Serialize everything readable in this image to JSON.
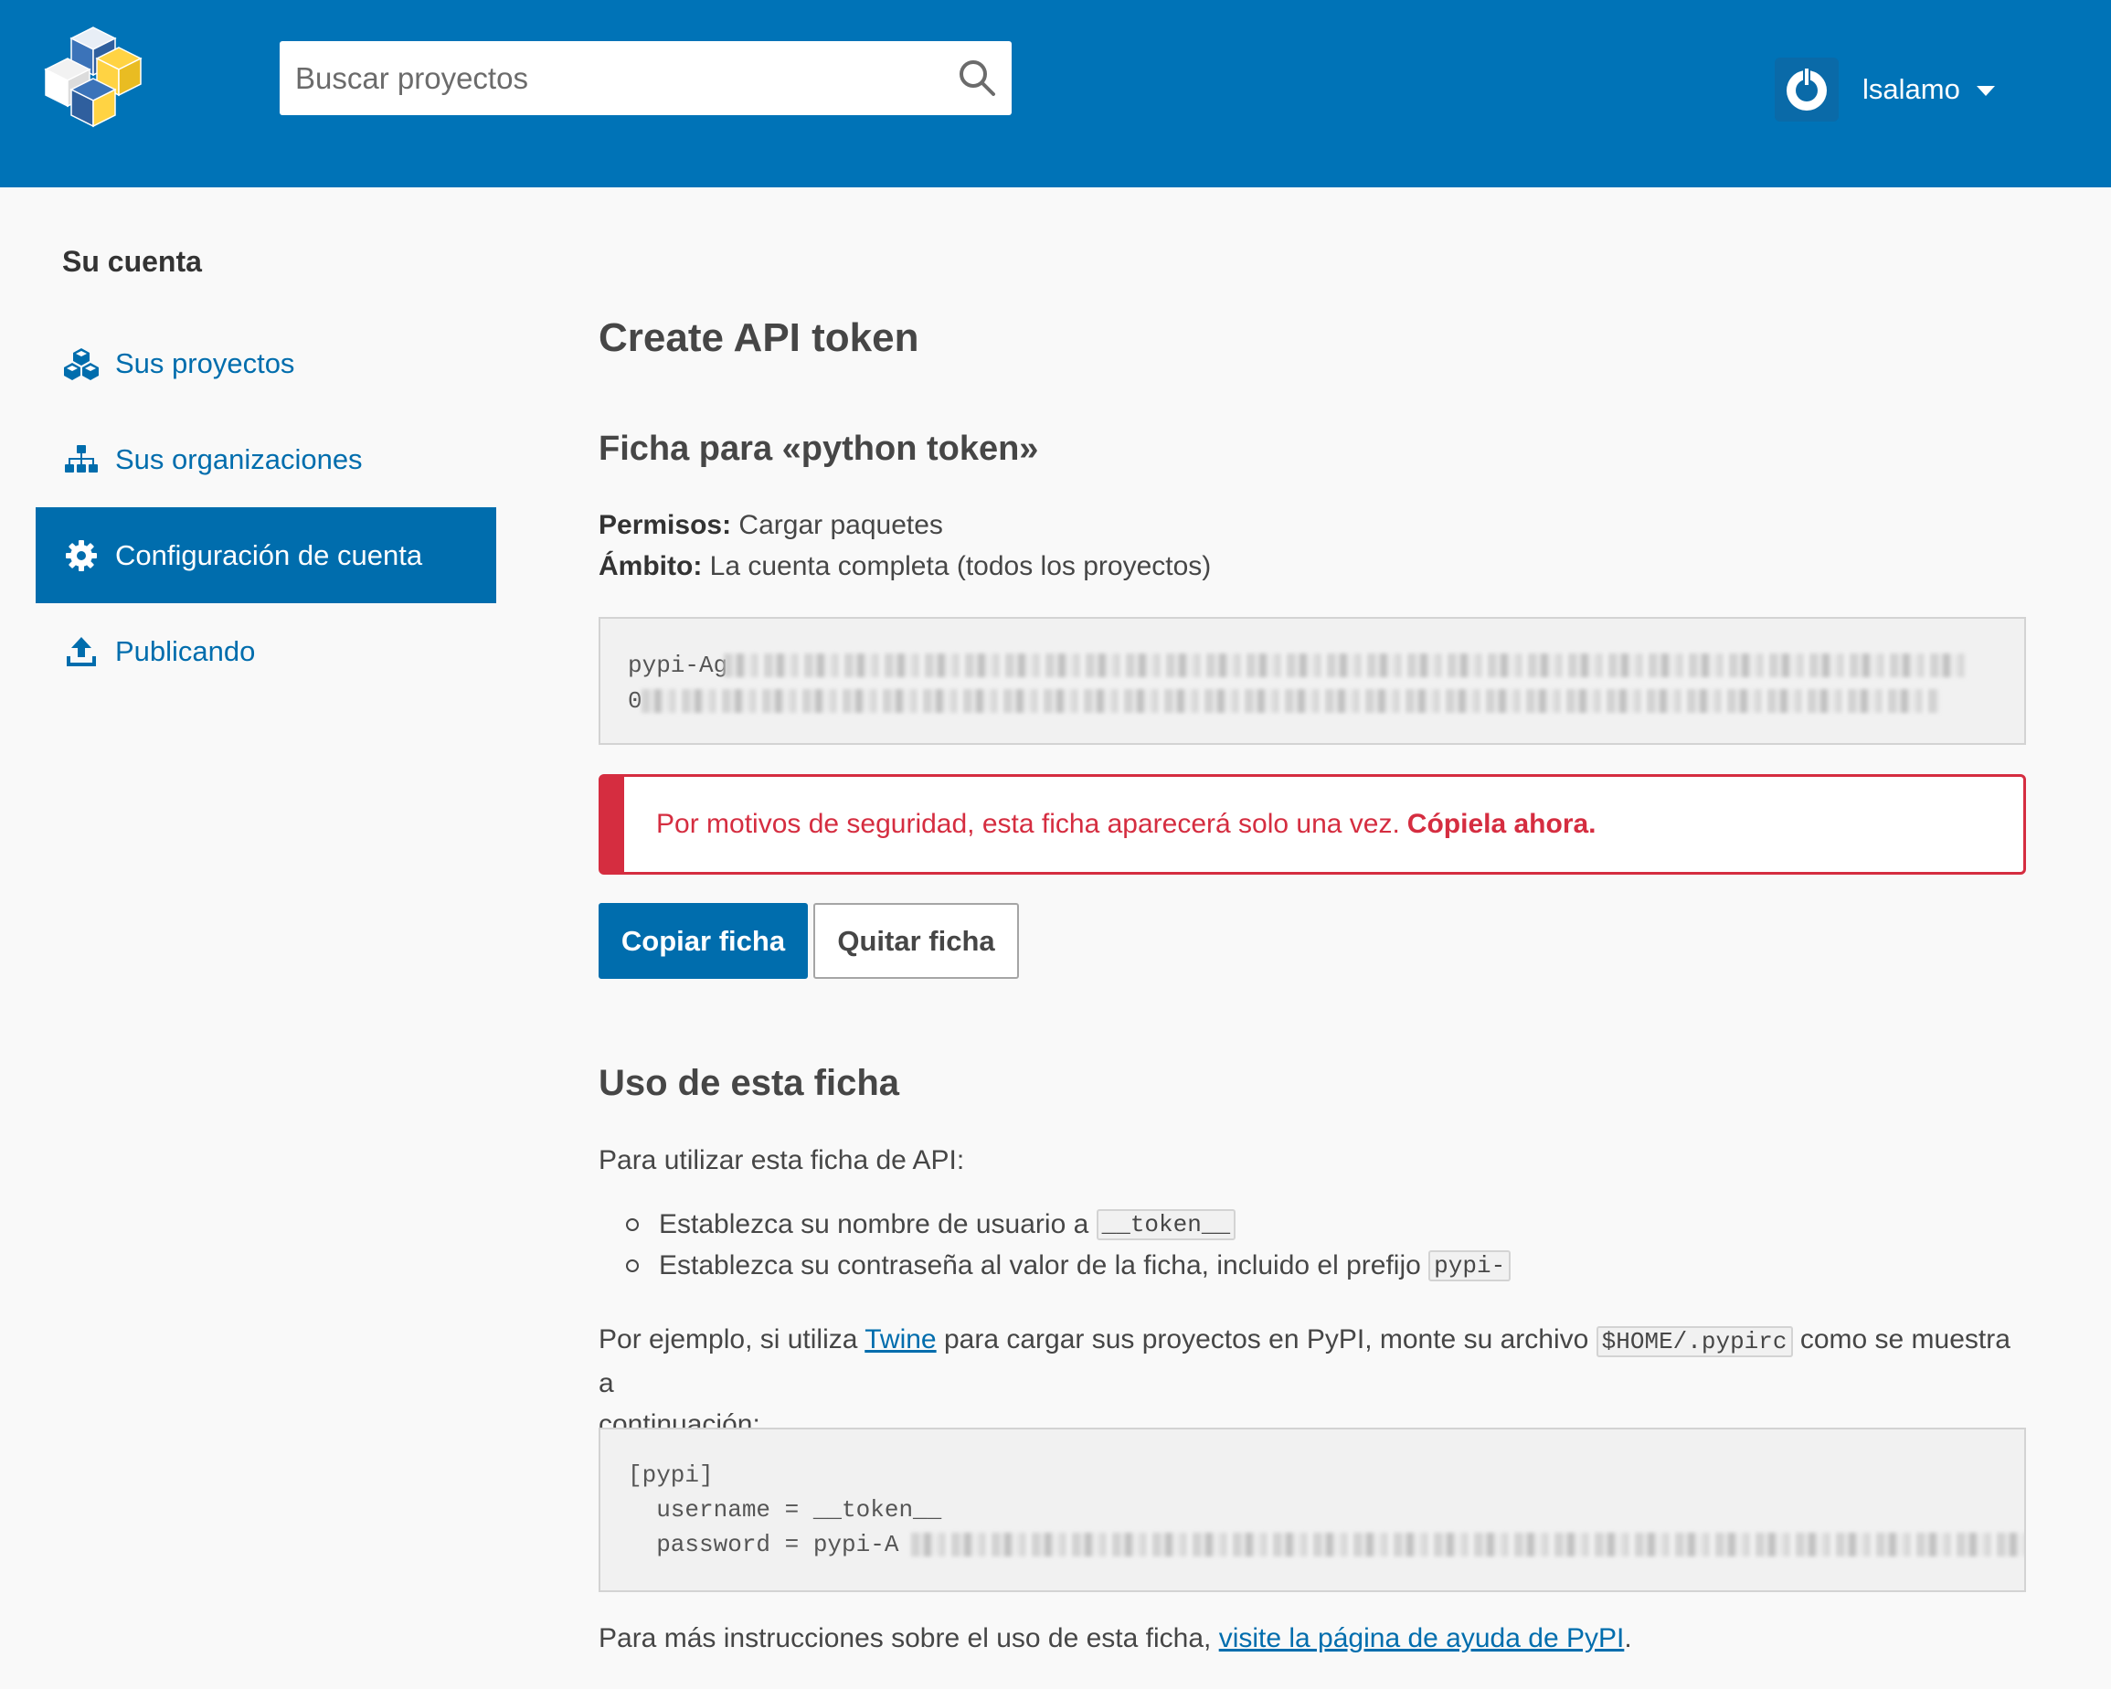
{
  "header": {
    "search_placeholder": "Buscar proyectos",
    "username": "lsalamo",
    "brand_color": "#0073b7"
  },
  "sidebar": {
    "title": "Su cuenta",
    "items": [
      {
        "label": "Sus proyectos",
        "icon": "cubes-icon",
        "active": false
      },
      {
        "label": "Sus organizaciones",
        "icon": "sitemap-icon",
        "active": false
      },
      {
        "label": "Configuración de cuenta",
        "icon": "gear-icon",
        "active": true
      },
      {
        "label": "Publicando",
        "icon": "upload-icon",
        "active": false
      }
    ]
  },
  "main": {
    "title": "Create API token",
    "token_heading": "Ficha para «python token»",
    "permissions_label": "Permisos:",
    "permissions_value": "Cargar paquetes",
    "scope_label": "Ámbito:",
    "scope_value": "La cuenta completa (todos los proyectos)",
    "token_prefix": "pypi-Ag",
    "token_line2_prefix": "0",
    "alert_text": "Por motivos de seguridad, esta ficha aparecerá solo una vez.",
    "alert_strong": "Cópiela ahora.",
    "copy_button": "Copiar ficha",
    "remove_button": "Quitar ficha",
    "usage_heading": "Uso de esta ficha",
    "usage_intro": "Para utilizar esta ficha de API:",
    "steps": [
      {
        "text": "Establezca su nombre de usuario a",
        "code": "__token__"
      },
      {
        "text": "Establezca su contraseña al valor de la ficha, incluido el prefijo",
        "code": "pypi-"
      }
    ],
    "example_pre": "Por ejemplo, si utiliza",
    "example_link": "Twine",
    "example_mid": "para cargar sus proyectos en PyPI, monte su archivo",
    "example_code": "$HOME/.pypirc",
    "example_post": "como se muestra a",
    "example_post2": "continuación:",
    "config_section": "[pypi]",
    "config_username": "  username = __token__",
    "config_password": "  password = pypi-A",
    "footer_pre": "Para más instrucciones sobre el uso de esta ficha,",
    "footer_link": "visite la página de ayuda de PyPI",
    "footer_post": "."
  },
  "colors": {
    "link": "#006dad",
    "alert": "#d52d40"
  }
}
